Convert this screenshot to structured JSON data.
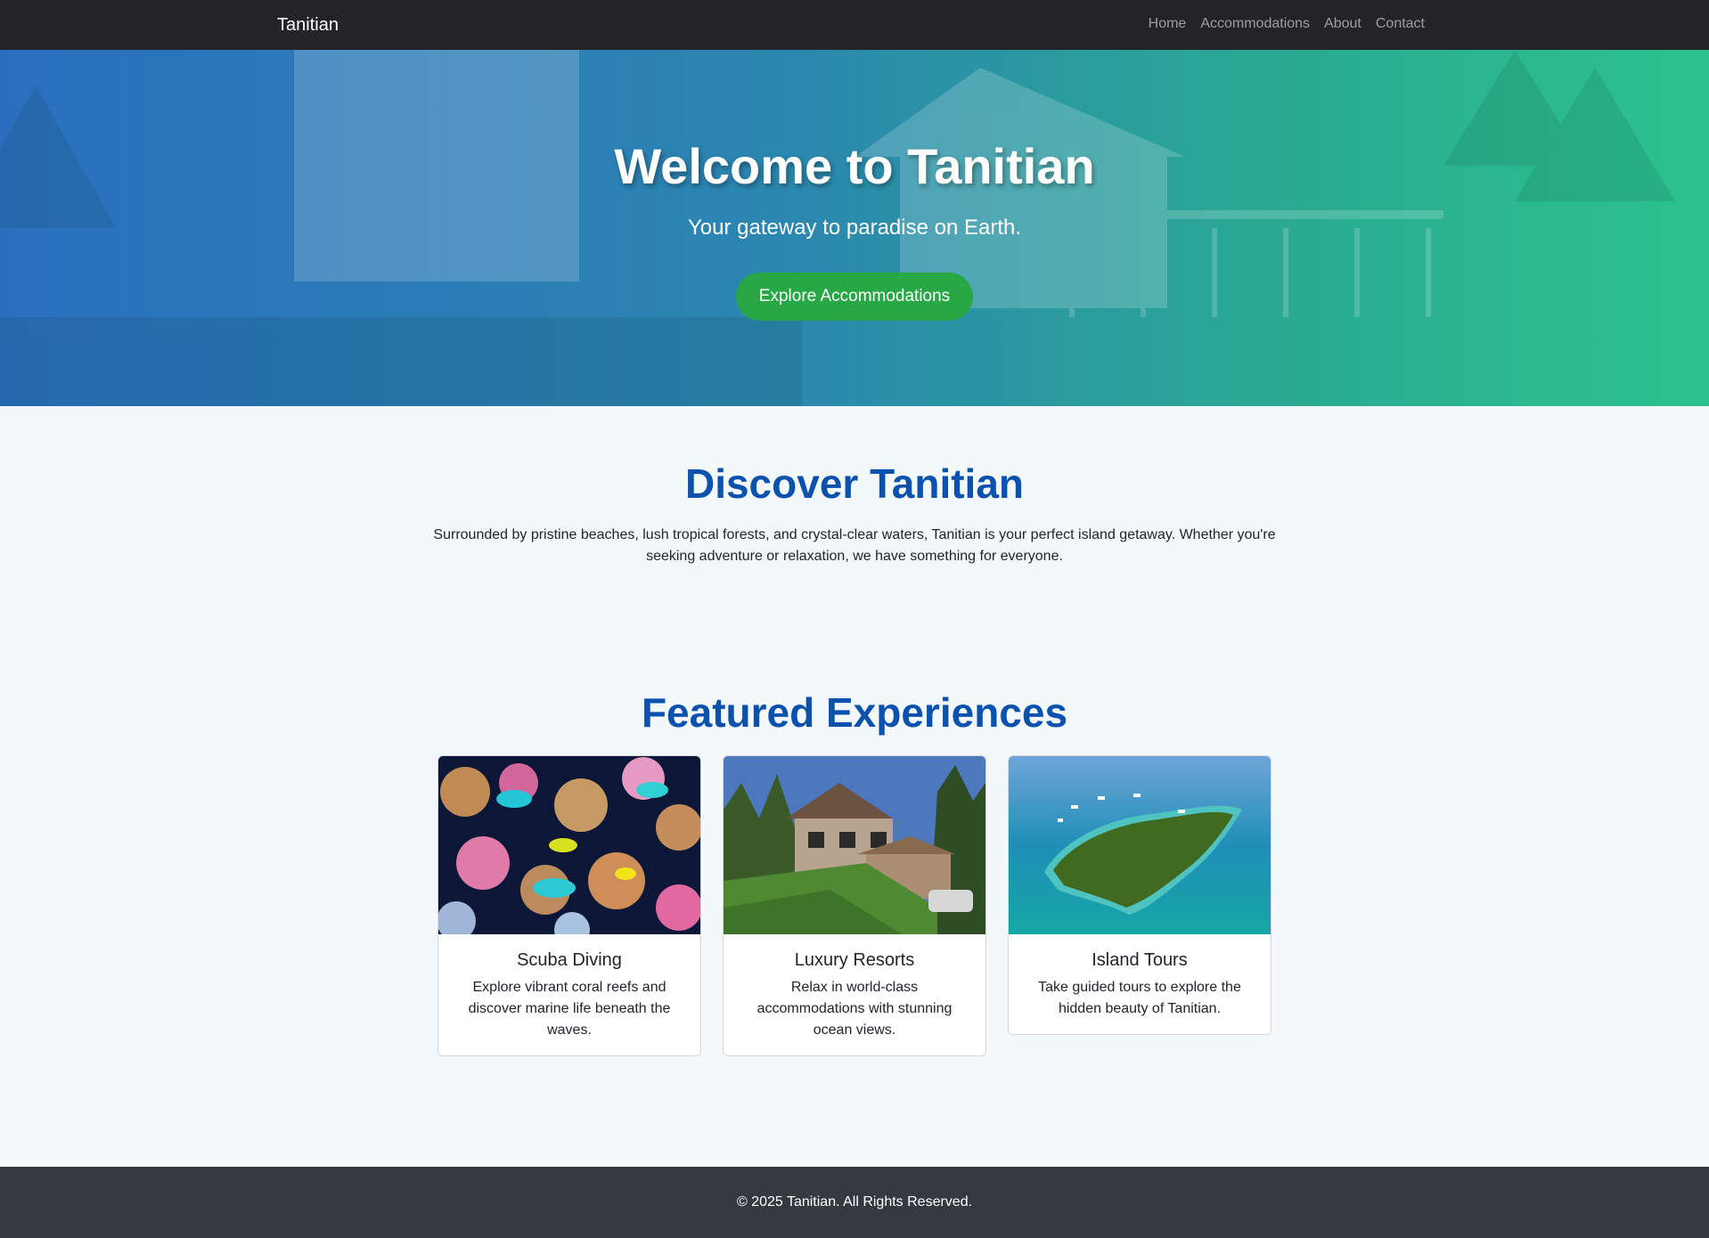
{
  "nav": {
    "brand": "Tanitian",
    "links": [
      "Home",
      "Accommodations",
      "About",
      "Contact"
    ]
  },
  "hero": {
    "title": "Welcome to Tanitian",
    "subtitle": "Your gateway to paradise on Earth.",
    "cta": "Explore Accommodations"
  },
  "discover": {
    "title": "Discover Tanitian",
    "text": "Surrounded by pristine beaches, lush tropical forests, and crystal-clear waters, Tanitian is your perfect island getaway. Whether you're seeking adventure or relaxation, we have something for everyone."
  },
  "featured": {
    "title": "Featured Experiences",
    "cards": [
      {
        "title": "Scuba Diving",
        "text": "Explore vibrant coral reefs and discover marine life beneath the waves.",
        "image": "coral-reef-fish-photo"
      },
      {
        "title": "Luxury Resorts",
        "text": "Relax in world-class accommodations with stunning ocean views.",
        "image": "mountain-lodge-photo"
      },
      {
        "title": "Island Tours",
        "text": "Take guided tours to explore the hidden beauty of Tanitian.",
        "image": "aerial-island-photo"
      }
    ]
  },
  "footer": {
    "text": "© 2025 Tanitian. All Rights Reserved."
  },
  "colors": {
    "navbar": "#212529",
    "accent_green": "#28a745",
    "heading_blue": "#0a52ad",
    "footer": "#343a40",
    "page_bg": "#f3f8fa"
  }
}
